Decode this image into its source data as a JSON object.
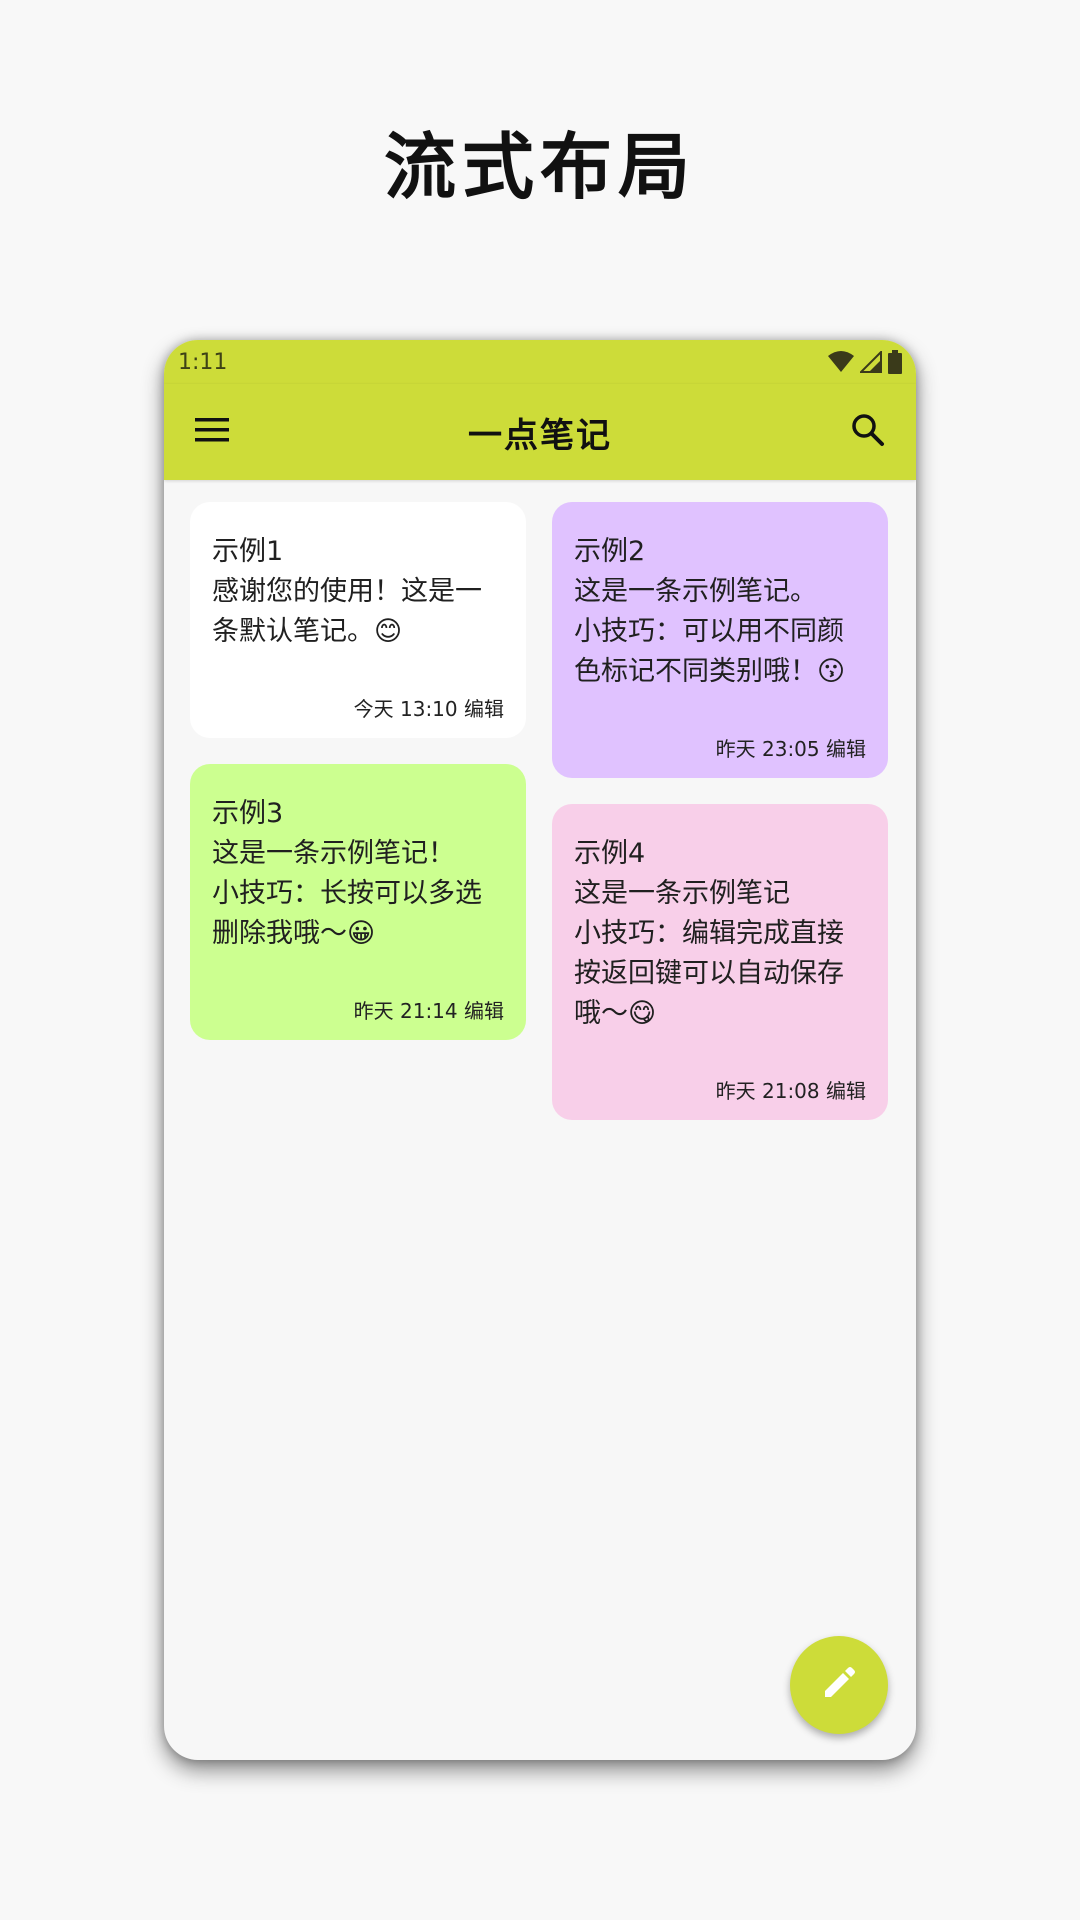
{
  "promo": {
    "title": "流式布局"
  },
  "statusbar": {
    "time": "1:11",
    "icons": [
      "wifi-icon",
      "signal-icon",
      "battery-icon"
    ]
  },
  "appbar": {
    "title": "一点笔记",
    "menu_icon": "menu-icon",
    "search_icon": "search-icon"
  },
  "notes": [
    {
      "title": "示例1",
      "body": "感谢您的使用！这是一\n条默认笔记。😊",
      "footer": "今天 13:10 编辑",
      "color": "#ffffff"
    },
    {
      "title": "示例2",
      "body": "这是一条示例笔记。\n小技巧：可以用不同颜\n色标记不同类别哦！😗",
      "footer": "昨天 23:05 编辑",
      "color": "#e0c2ff"
    },
    {
      "title": "示例3",
      "body": "这是一条示例笔记！\n小技巧：长按可以多选\n删除我哦～😀",
      "footer": "昨天 21:14 编辑",
      "color": "#ccff90"
    },
    {
      "title": "示例4",
      "body": "这是一条示例笔记\n小技巧：编辑完成直接\n按返回键可以自动保存\n哦～😋",
      "footer": "昨天 21:08 编辑",
      "color": "#f8cfe9"
    }
  ],
  "fab": {
    "icon": "edit-icon"
  },
  "colors": {
    "accent": "#cddc39",
    "background": "#f7f7f7"
  }
}
